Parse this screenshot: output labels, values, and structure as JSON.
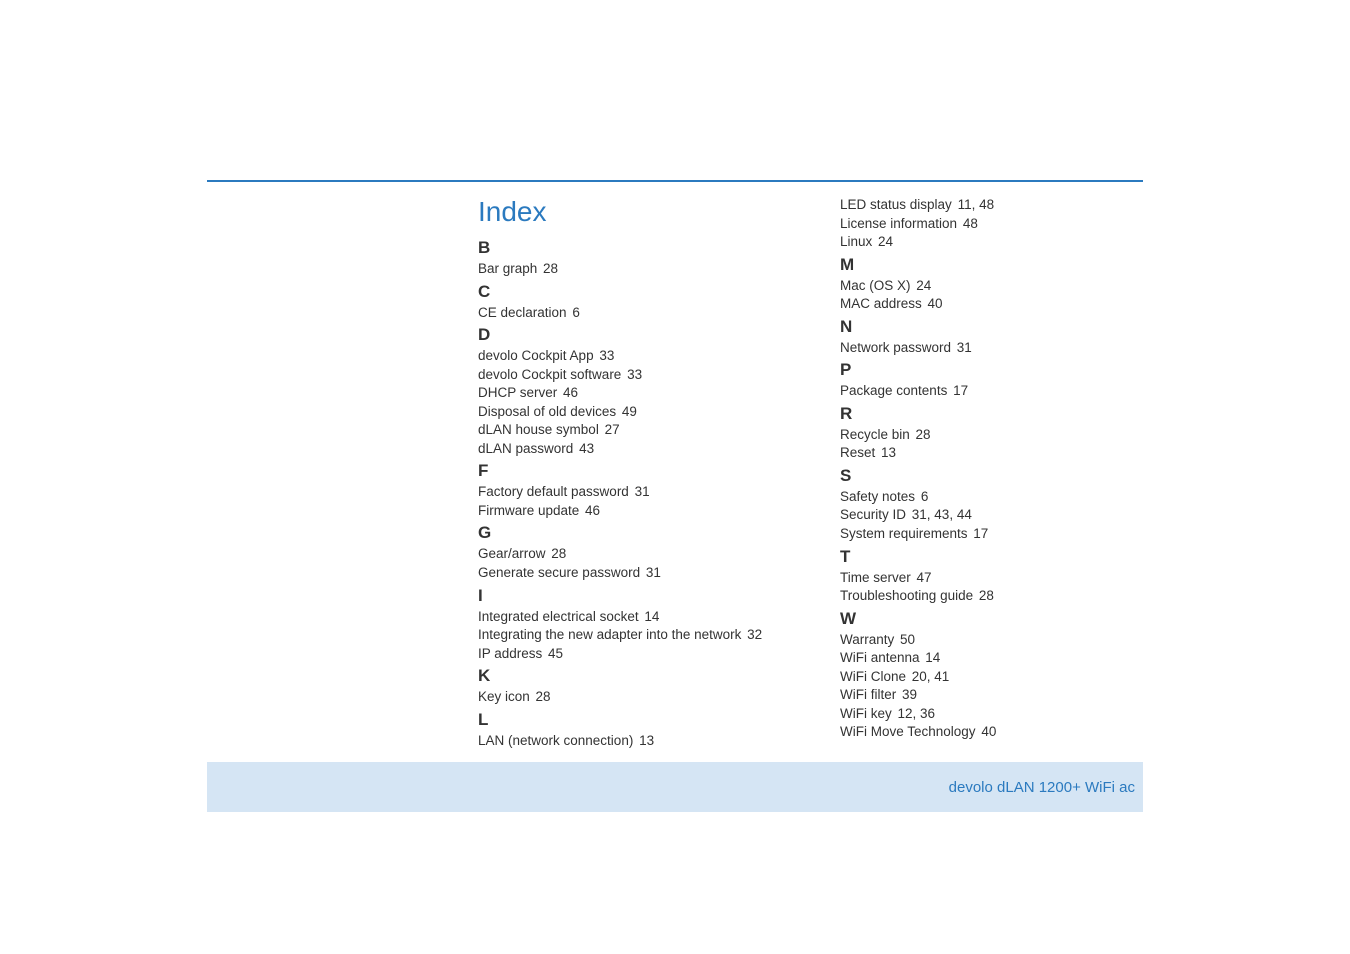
{
  "heading": "Index",
  "footer": "devolo dLAN 1200+ WiFi ac",
  "left": [
    {
      "type": "letter",
      "text": "B"
    },
    {
      "type": "entry",
      "label": "Bar graph",
      "pages": "28"
    },
    {
      "type": "letter",
      "text": "C"
    },
    {
      "type": "entry",
      "label": "CE declaration",
      "pages": "6"
    },
    {
      "type": "letter",
      "text": "D"
    },
    {
      "type": "entry",
      "label": "devolo Cockpit App",
      "pages": "33"
    },
    {
      "type": "entry",
      "label": "devolo Cockpit software",
      "pages": "33"
    },
    {
      "type": "entry",
      "label": "DHCP server",
      "pages": "46"
    },
    {
      "type": "entry",
      "label": "Disposal of old devices",
      "pages": "49"
    },
    {
      "type": "entry",
      "label": "dLAN house symbol",
      "pages": "27"
    },
    {
      "type": "entry",
      "label": "dLAN password",
      "pages": "43"
    },
    {
      "type": "letter",
      "text": "F"
    },
    {
      "type": "entry",
      "label": "Factory default password",
      "pages": "31"
    },
    {
      "type": "entry",
      "label": "Firmware update",
      "pages": "46"
    },
    {
      "type": "letter",
      "text": "G"
    },
    {
      "type": "entry",
      "label": "Gear/arrow",
      "pages": "28"
    },
    {
      "type": "entry",
      "label": "Generate secure password",
      "pages": "31"
    },
    {
      "type": "letter",
      "text": "I"
    },
    {
      "type": "entry",
      "label": "Integrated electrical socket",
      "pages": "14"
    },
    {
      "type": "entry",
      "label": "Integrating the new adapter into the network",
      "pages": "32"
    },
    {
      "type": "entry",
      "label": "IP address",
      "pages": "45"
    },
    {
      "type": "letter",
      "text": "K"
    },
    {
      "type": "entry",
      "label": "Key icon",
      "pages": "28"
    },
    {
      "type": "letter",
      "text": "L"
    },
    {
      "type": "entry",
      "label": "LAN (network connection)",
      "pages": "13"
    }
  ],
  "right": [
    {
      "type": "entry",
      "label": "LED status display",
      "pages": "11, 48"
    },
    {
      "type": "entry",
      "label": "License information",
      "pages": "48"
    },
    {
      "type": "entry",
      "label": "Linux",
      "pages": "24"
    },
    {
      "type": "letter",
      "text": "M"
    },
    {
      "type": "entry",
      "label": "Mac (OS X)",
      "pages": "24"
    },
    {
      "type": "entry",
      "label": "MAC address",
      "pages": "40"
    },
    {
      "type": "letter",
      "text": "N"
    },
    {
      "type": "entry",
      "label": "Network password",
      "pages": "31"
    },
    {
      "type": "letter",
      "text": "P"
    },
    {
      "type": "entry",
      "label": "Package contents",
      "pages": "17"
    },
    {
      "type": "letter",
      "text": "R"
    },
    {
      "type": "entry",
      "label": "Recycle bin",
      "pages": "28"
    },
    {
      "type": "entry",
      "label": "Reset",
      "pages": "13"
    },
    {
      "type": "letter",
      "text": "S"
    },
    {
      "type": "entry",
      "label": "Safety notes",
      "pages": "6"
    },
    {
      "type": "entry",
      "label": "Security ID",
      "pages": "31, 43, 44"
    },
    {
      "type": "entry",
      "label": "System requirements",
      "pages": "17"
    },
    {
      "type": "letter",
      "text": "T"
    },
    {
      "type": "entry",
      "label": "Time server",
      "pages": "47"
    },
    {
      "type": "entry",
      "label": "Troubleshooting guide",
      "pages": "28"
    },
    {
      "type": "letter",
      "text": "W"
    },
    {
      "type": "entry",
      "label": "Warranty",
      "pages": "50"
    },
    {
      "type": "entry",
      "label": "WiFi antenna",
      "pages": "14"
    },
    {
      "type": "entry",
      "label": "WiFi Clone",
      "pages": "20, 41"
    },
    {
      "type": "entry",
      "label": "WiFi filter",
      "pages": "39"
    },
    {
      "type": "entry",
      "label": "WiFi key",
      "pages": "12, 36"
    },
    {
      "type": "entry",
      "label": "WiFi Move Technology",
      "pages": "40"
    }
  ]
}
